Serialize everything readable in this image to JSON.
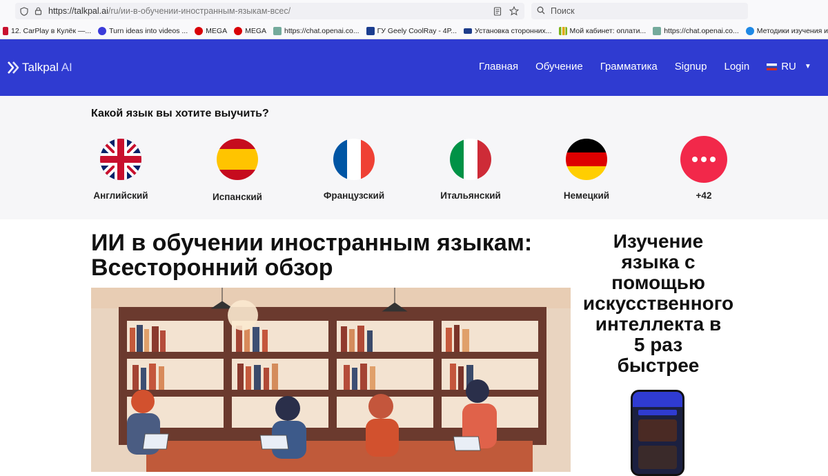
{
  "browser": {
    "url_host": "https://talkpal.ai",
    "url_path": "/ru/ии-в-обучении-иностранным-языкам-всес/",
    "search_placeholder": "Поиск",
    "bookmarks": [
      {
        "label": "12. CarPlay в Кулёк —...",
        "color": "#c8102e"
      },
      {
        "label": "Turn ideas into videos ...",
        "color": "#3b3bd9"
      },
      {
        "label": "MEGA",
        "color": "#d90007"
      },
      {
        "label": "MEGA",
        "color": "#d90007"
      },
      {
        "label": "https://chat.openai.co...",
        "color": "#74aa9c"
      },
      {
        "label": "ГУ Geely CoolRay - 4P...",
        "color": "#1b3d8f"
      },
      {
        "label": "Установка сторонних...",
        "color": "#1d3c8a"
      },
      {
        "label": "Мой кабинет: оплати...",
        "color": "#7bb31a"
      },
      {
        "label": "https://chat.openai.co...",
        "color": "#74aa9c"
      },
      {
        "label": "Методики изучения и...",
        "color": "#1e88e5"
      }
    ]
  },
  "site": {
    "logo_name": "Talkpal",
    "logo_suffix": "AI",
    "nav": [
      "Главная",
      "Обучение",
      "Грамматика",
      "Signup",
      "Login"
    ],
    "language": "RU",
    "accent": "#2f3bd1"
  },
  "picker": {
    "heading": "Какой язык вы хотите выучить?",
    "languages": [
      "Английский",
      "Испанский",
      "Французский",
      "Итальянский",
      "Немецкий",
      "+42"
    ]
  },
  "article": {
    "title_line1": "ИИ в обучении иностранным языкам:",
    "title_line2": "Всесторонний обзор"
  },
  "sidebar": {
    "promo_lines": [
      "Изучение",
      "языка с",
      "помощью",
      "искусственного",
      "интеллекта в",
      "5 раз",
      "быстрее"
    ]
  }
}
